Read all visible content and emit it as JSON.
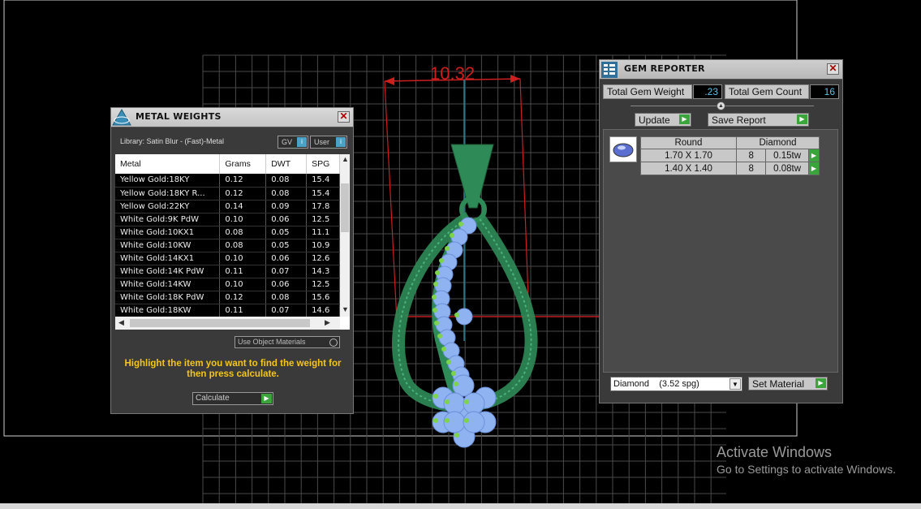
{
  "viewport": {
    "dimension_label": "10.32"
  },
  "metal_weights": {
    "title": "METAL WEIGHTS",
    "library_label": "Library: Satin Blur - (Fast)-Metal",
    "gv_toggle": "GV",
    "user_toggle": "User",
    "columns": [
      "Metal",
      "Grams",
      "DWT",
      "SPG"
    ],
    "rows": [
      [
        "Yellow Gold:18KY",
        "0.12",
        "0.08",
        "15.4"
      ],
      [
        "Yellow Gold:18KY R...",
        "0.12",
        "0.08",
        "15.4"
      ],
      [
        "Yellow Gold:22KY",
        "0.14",
        "0.09",
        "17.8"
      ],
      [
        "White Gold:9K PdW",
        "0.10",
        "0.06",
        "12.5"
      ],
      [
        "White Gold:10KX1",
        "0.08",
        "0.05",
        "11.1"
      ],
      [
        "White Gold:10KW",
        "0.08",
        "0.05",
        "10.9"
      ],
      [
        "White Gold:14KX1",
        "0.10",
        "0.06",
        "12.6"
      ],
      [
        "White Gold:14K PdW",
        "0.11",
        "0.07",
        "14.3"
      ],
      [
        "White Gold:14KW",
        "0.10",
        "0.06",
        "12.5"
      ],
      [
        "White Gold:18K PdW",
        "0.12",
        "0.08",
        "15.6"
      ],
      [
        "White Gold:18KW",
        "0.11",
        "0.07",
        "14.6"
      ]
    ],
    "use_object_materials": "Use Object Materials",
    "hint": "Highlight the item you want to find the weight for then press calculate.",
    "calculate_label": "Calculate"
  },
  "gem_reporter": {
    "title": "GEM REPORTER",
    "total_weight_label": "Total Gem Weight",
    "total_weight_value": ".23",
    "total_count_label": "Total Gem Count",
    "total_count_value": "16",
    "update_label": "Update",
    "save_report_label": "Save Report",
    "table_headers": [
      "Round",
      "Diamond"
    ],
    "rows": [
      [
        "1.70 X 1.70",
        "8",
        "0.15tw"
      ],
      [
        "1.40 X 1.40",
        "8",
        "0.08tw"
      ]
    ],
    "material_select": "Diamond    (3.52 spg)",
    "set_material_label": "Set Material"
  },
  "watermark": {
    "line1": "Activate Windows",
    "line2": "Go to Settings to activate Windows."
  },
  "colors": {
    "grid": "#4a4a4a",
    "model_green": "#2e8b57",
    "stone_blue": "#8fb3f0",
    "dimension_red": "#cc1f1f",
    "axis_cyan": "#2aa0b8",
    "hint_yellow": "#f5c518"
  }
}
